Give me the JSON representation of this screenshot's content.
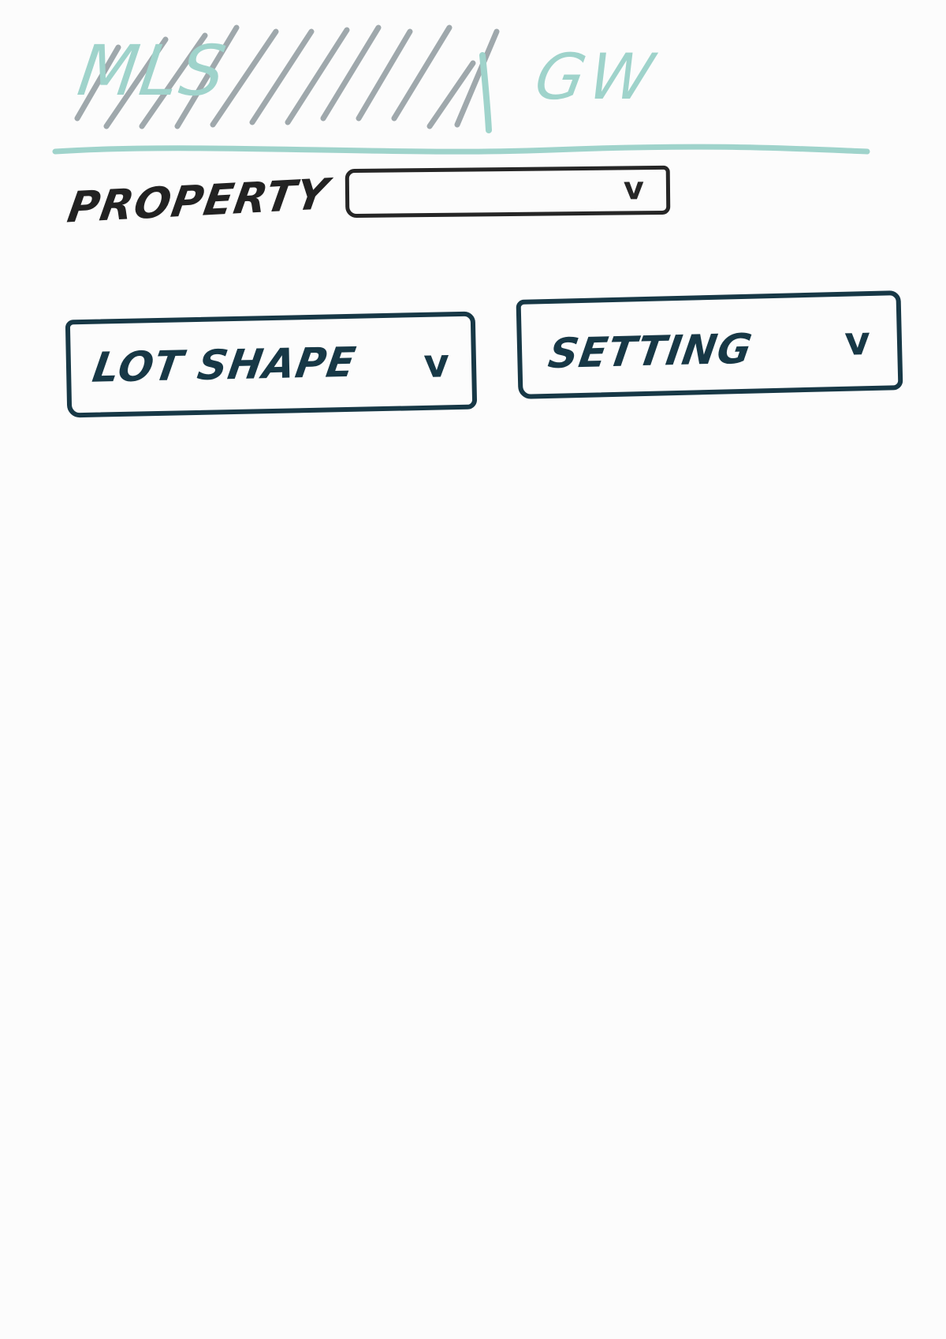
{
  "header": {
    "title": "MLS",
    "title_right": "GW",
    "accent_color": "#9fd3cb",
    "hatch_color": "#8f9a9f"
  },
  "property": {
    "label": "PROPERTY",
    "selected_value": "",
    "chevron": "v",
    "stroke_color": "#262626"
  },
  "filters": {
    "stroke_color": "#173846",
    "lot_shape": {
      "label": "LOT SHAPE",
      "chevron": "v"
    },
    "setting": {
      "label": "SETTING",
      "chevron": "v"
    }
  }
}
